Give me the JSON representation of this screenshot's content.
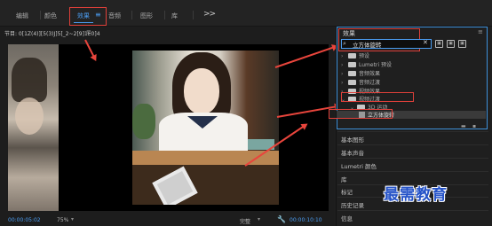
{
  "topbar": {
    "tabs": [
      {
        "label": "编辑"
      },
      {
        "label": "颜色"
      },
      {
        "label": "效果"
      },
      {
        "label": "音频"
      },
      {
        "label": "图形"
      },
      {
        "label": "库"
      }
    ],
    "active_tab_menu": "≡",
    "more": ">>"
  },
  "monitor": {
    "title": "节目: 0[1Z(4)][5(3)J]5[_2~2[9]1E0]4",
    "menu": "≡",
    "timecode_current": "00:00:05:02",
    "zoom": "75%",
    "quality": "完整",
    "timecode_duration": "00:00:10:10"
  },
  "effects": {
    "title": "效果",
    "menu": "≡",
    "search_value": "立方体旋转",
    "tree": [
      {
        "label": "预设",
        "open": false
      },
      {
        "label": "Lumetri 预设",
        "open": false
      },
      {
        "label": "音频效果",
        "open": false
      },
      {
        "label": "音频过渡",
        "open": false
      },
      {
        "label": "视频效果",
        "open": false
      },
      {
        "label": "视频过渡",
        "open": true
      },
      {
        "label": "3D 运动",
        "open": true
      },
      {
        "label": "立方体旋转",
        "leaf": true
      }
    ],
    "sections": [
      "基本图形",
      "基本声音",
      "Lumetri 颜色",
      "库",
      "标记",
      "历史记录",
      "信息"
    ]
  },
  "watermark": "最需教育",
  "colors": {
    "accent": "#4b9cf0",
    "annotation_red": "#e8453c",
    "watermark_blue": "#2553c8"
  }
}
